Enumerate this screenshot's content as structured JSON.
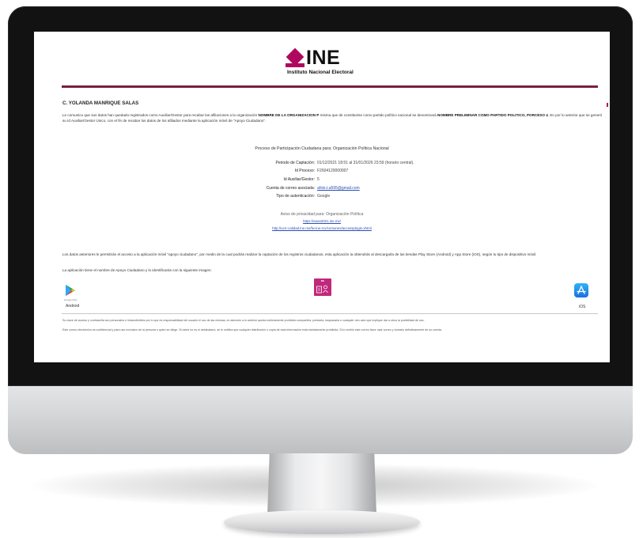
{
  "header": {
    "logo_text": "INE",
    "logo_subtitle": "Instituto Nacional Electoral",
    "brand_color": "#b0085e"
  },
  "email": {
    "recipient": "C. YOLANDA MANRIQUE SALAS",
    "intro_part1": "Le comunico que sus datos han quedado registrados como Auxiliar/Gestor para recabar las afiliaciones a la organización ",
    "intro_org": "NOMBRE DE LA ORGANIZACION P",
    "intro_part2": " misma que de constituirse como partido político nacional se denominará ",
    "intro_party": "NOMBRE PRELIMINAR COMO PARTIDO POLITICO, PORCESO 4",
    "intro_part3": ". En por lo anterior que se generó su Id Auxiliar/Gestor Único, con el fin de recabar los datos de los afiliados mediante la aplicación móvil de \"Apoyo Ciudadano\"."
  },
  "info": {
    "title": "Proceso de Participación Ciudadana para: Organización Política Nacional",
    "rows": [
      {
        "label": "Periodo de Captación:",
        "value": "01/12/2021 18:51 al 31/01/2026 23:59 (horario central)."
      },
      {
        "label": "Id Proceso:",
        "value": "F2604120000007"
      },
      {
        "label": "Id Auxiliar/Gestor:",
        "value": "5"
      },
      {
        "label": "Cuenta de correo asociada:",
        "value": "ahiio.t.a595@gmail.com"
      },
      {
        "label": "Tipo de autenticación:",
        "value": "Google"
      }
    ]
  },
  "privacy": {
    "title": "Aviso de privacidad para: Organización Política",
    "link1": "https://aoas2021.ine.mx/",
    "link2": "http://ucrr-calidad.ine.mx/fw-ine-rcv/comunes/accessplogin.xhtml"
  },
  "body": {
    "para2": "Los datos anteriores le permitirán el acceso a la aplicación móvil \"apoyo ciudadano\", por medio de la cual podrás realizar la captación de los registros ciudadanos, esta aplicación la obtendrás al descargarla de las tiendas Play Store (Android) y App Store (iOS), según tu tipo de dispositivo móvil.",
    "para3": "La aplicación tiene el nombre de Apoyo Ciudadano y lo identificarás con la siguiente imagen:"
  },
  "apps": {
    "android_label": "Android",
    "play_sub": "Google Play",
    "apoyo_badge": "INE",
    "ios_label": "iOS"
  },
  "footer": {
    "line1": "Su clave de acceso y contraseña son personales e intransferibles por lo que es responsabilidad del usuario el uso de las mismas, en atención a lo anterior queda estrictamente prohibido compartirla, prestarla, traspasarla o cualquier otro acto que implique dar a otros la posibilidad de uso.",
    "line2": "Este correo electrónico es confidencial y para uso exclusivo de la persona o quien se dirige. Si usted no es el destinatario, se le notifica que cualquier distribución o copia de esta información está estrictamente prohibida. Si lo recibió este correo favor usar correo y borrarlo definitivamente de su cuenta."
  }
}
